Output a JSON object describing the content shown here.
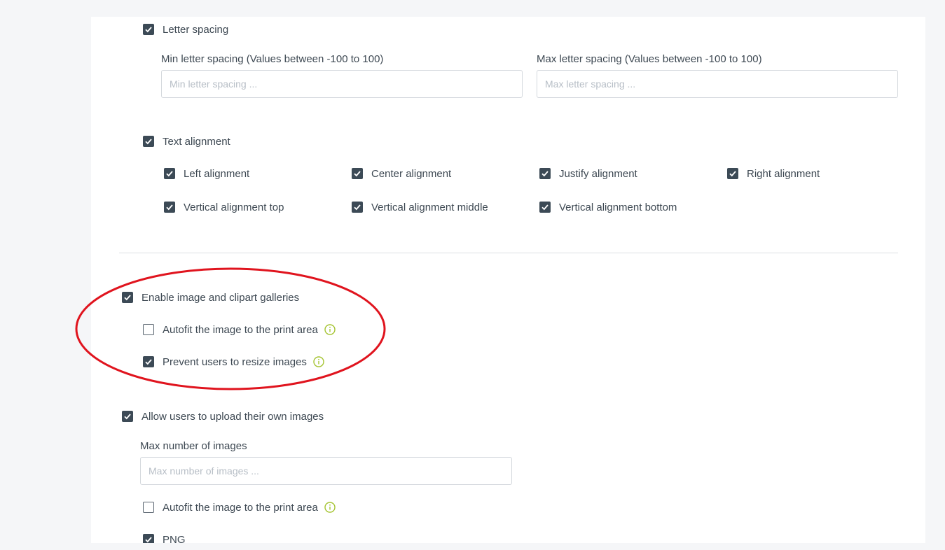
{
  "letter_spacing": {
    "label": "Letter spacing",
    "checked": true,
    "min": {
      "label": "Min letter spacing (Values between -100 to 100)",
      "placeholder": "Min letter spacing ...",
      "value": ""
    },
    "max": {
      "label": "Max letter spacing (Values between -100 to 100)",
      "placeholder": "Max letter spacing ...",
      "value": ""
    }
  },
  "text_alignment": {
    "label": "Text alignment",
    "checked": true,
    "options": [
      {
        "label": "Left alignment",
        "checked": true
      },
      {
        "label": "Center alignment",
        "checked": true
      },
      {
        "label": "Justify alignment",
        "checked": true
      },
      {
        "label": "Right alignment",
        "checked": true
      },
      {
        "label": "Vertical alignment top",
        "checked": true
      },
      {
        "label": "Vertical alignment middle",
        "checked": true
      },
      {
        "label": "Vertical alignment bottom",
        "checked": true
      }
    ]
  },
  "galleries": {
    "label": "Enable image and clipart galleries",
    "checked": true,
    "autofit": {
      "label": "Autofit the image to the print area",
      "checked": false
    },
    "prevent_resize": {
      "label": "Prevent users to resize images",
      "checked": true
    }
  },
  "upload": {
    "label": "Allow users to upload their own images",
    "checked": true,
    "max_images": {
      "label": "Max number of images",
      "placeholder": "Max number of images ...",
      "value": ""
    },
    "autofit": {
      "label": "Autofit the image to the print area",
      "checked": false
    },
    "formats": [
      {
        "label": "PNG",
        "checked": true
      }
    ]
  },
  "colors": {
    "checkbox_fill": "#3c4a56",
    "info_icon": "#a5c432",
    "annotation": "#e0141e"
  }
}
